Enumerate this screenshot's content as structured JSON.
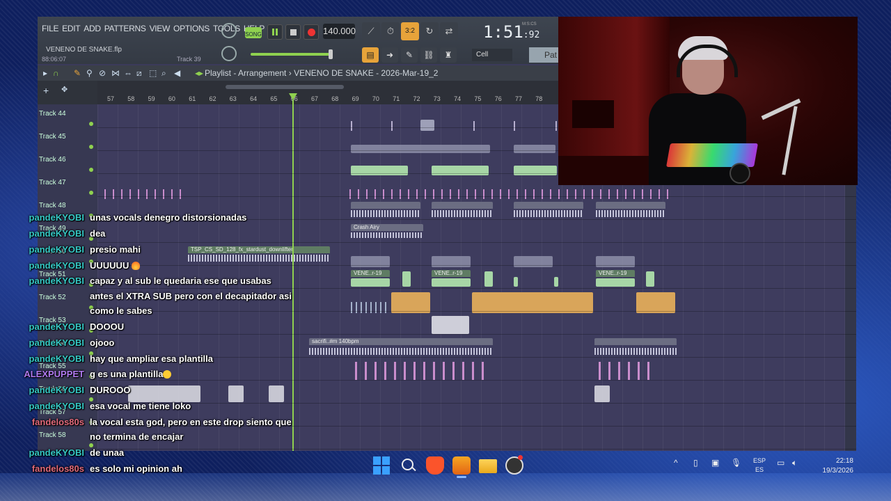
{
  "fl": {
    "menu": [
      "FILE",
      "EDIT",
      "ADD",
      "PATTERNS",
      "VIEW",
      "OPTIONS",
      "TOOLS",
      "HELP"
    ],
    "project_file": "VENENO DE SNAKE.flp",
    "project_time": "88:06:07",
    "track_hint": "Track 39",
    "song_mode_label": "SONG",
    "tempo": "140.000",
    "clock": "1:51",
    "clock_sub": ":92",
    "clock_unit": "M:S:CS",
    "pattern_snap": "3:2",
    "cell_select": "Cell",
    "pattern_label": "Pat",
    "playlist_title": "Playlist - Arrangement",
    "playlist_breadcrumb": "VENENO DE SNAKE - 2026-Mar-19_2",
    "ruler": [
      "57",
      "58",
      "59",
      "60",
      "61",
      "62",
      "63",
      "64",
      "65",
      "66",
      "67",
      "68",
      "69",
      "70",
      "71",
      "72",
      "73",
      "74",
      "75",
      "76",
      "77",
      "78"
    ],
    "tracks": [
      "Track 44",
      "Track 45",
      "Track 46",
      "Track 47",
      "Track 48",
      "Track 49",
      "Track 50",
      "Track 51",
      "Track 52",
      "Track 53",
      "Track 54",
      "Track 55",
      "Track 56",
      "Track 57",
      "Track 58"
    ],
    "clips": {
      "crash": "Crash Airy",
      "downlifter": "TSP_CS_SD_128_fx_stardust_downlifter",
      "vene1": "VENE..r-19",
      "vene2": "VENE..r-19",
      "vene3": "VENE..r-19",
      "sacrifi": "sacrifi..#m 140bpm"
    }
  },
  "chat": [
    {
      "user": "pandeKYOBI",
      "color": "#36c9c6",
      "text": "unas vocals denegro distorsionadas"
    },
    {
      "user": "pandeKYOBI",
      "color": "#36c9c6",
      "text": "dea"
    },
    {
      "user": "pandeKYOBI",
      "color": "#36c9c6",
      "text": "presio mahi"
    },
    {
      "user": "pandeKYOBI",
      "color": "#36c9c6",
      "text": "UUUUUU"
    },
    {
      "user": "pandeKYOBI",
      "color": "#36c9c6",
      "text": "capaz y al sub le quedaria ese que usabas"
    },
    {
      "user": "",
      "color": "#36c9c6",
      "text": "antes el XTRA SUB pero con el decapitador asi"
    },
    {
      "user": "",
      "color": "#36c9c6",
      "text": "como le sabes"
    },
    {
      "user": "pandeKYOBI",
      "color": "#36c9c6",
      "text": "DOOOU"
    },
    {
      "user": "pandeKYOBI",
      "color": "#36c9c6",
      "text": "ojooo"
    },
    {
      "user": "pandeKYOBI",
      "color": "#36c9c6",
      "text": "hay que ampliar esa plantilla"
    },
    {
      "user": "ALEXPUPPET",
      "color": "#b07af0",
      "text": "g es una plantilla"
    },
    {
      "user": "pandeKYOBI",
      "color": "#36c9c6",
      "text": "DUROOO"
    },
    {
      "user": "pandeKYOBI",
      "color": "#36c9c6",
      "text": "esa vocal me tiene loko"
    },
    {
      "user": "fandelos80s",
      "color": "#e0697a",
      "text": "la vocal esta god, pero en este drop siento que"
    },
    {
      "user": "",
      "color": "#e0697a",
      "text": "no termina de encajar"
    },
    {
      "user": "pandeKYOBI",
      "color": "#36c9c6",
      "text": "de unaa"
    },
    {
      "user": "fandelos80s",
      "color": "#e0697a",
      "text": "es solo mi opinion ah"
    }
  ],
  "taskbar": {
    "lang_top": "ESP",
    "lang_bottom": "ES",
    "time": "22:18",
    "date": "19/3/2026"
  }
}
